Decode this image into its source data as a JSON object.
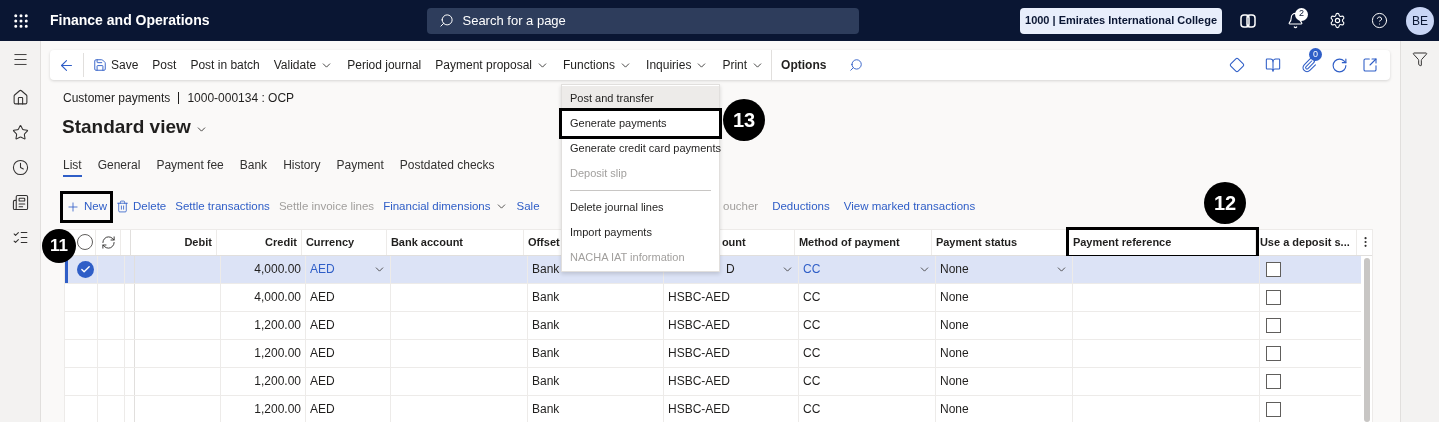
{
  "app": {
    "title": "Finance and Operations"
  },
  "search": {
    "placeholder": "Search for a page"
  },
  "company": "1000 | Emirates International College",
  "notifications": {
    "count": "2"
  },
  "avatar": "BE",
  "action_pane": {
    "items": [
      {
        "label": "Save",
        "kind": "save"
      },
      {
        "label": "Post",
        "kind": "plain"
      },
      {
        "label": "Post in batch",
        "kind": "plain"
      },
      {
        "label": "Validate",
        "kind": "dropdown"
      },
      {
        "label": "Period journal",
        "kind": "plain"
      },
      {
        "label": "Payment proposal",
        "kind": "dropdown"
      },
      {
        "label": "Functions",
        "kind": "dropdown"
      },
      {
        "label": "Inquiries",
        "kind": "dropdown"
      },
      {
        "label": "Print",
        "kind": "dropdown"
      },
      {
        "label": "Options",
        "kind": "bold"
      }
    ],
    "attachments_count": "0"
  },
  "breadcrumb": {
    "title": "Customer payments",
    "record": "1000-000134 : OCP"
  },
  "view": "Standard view",
  "tabs": [
    {
      "label": "List",
      "selected": true
    },
    {
      "label": "General",
      "selected": false
    },
    {
      "label": "Payment fee",
      "selected": false
    },
    {
      "label": "Bank",
      "selected": false
    },
    {
      "label": "History",
      "selected": false
    },
    {
      "label": "Payment",
      "selected": false
    },
    {
      "label": "Postdated checks",
      "selected": false
    }
  ],
  "grid_actions": [
    {
      "label": "New",
      "kind": "new",
      "disabled": false
    },
    {
      "label": "Delete",
      "kind": "delete",
      "disabled": false
    },
    {
      "label": "Settle transactions",
      "kind": "plain",
      "disabled": false
    },
    {
      "label": "Settle invoice lines",
      "kind": "plain",
      "disabled": true
    },
    {
      "label": "Financial dimensions",
      "kind": "dropdown",
      "disabled": false
    },
    {
      "label": "Sale",
      "kind": "plain",
      "disabled": false
    },
    {
      "label": "oucher",
      "kind": "after_menu",
      "disabled": true
    },
    {
      "label": "Deductions",
      "kind": "plain",
      "disabled": false
    },
    {
      "label": "View marked transactions",
      "kind": "plain",
      "disabled": false
    }
  ],
  "table": {
    "select_all": {
      "checked": false
    },
    "columns": [
      {
        "label": "Debit",
        "kind": "numeric"
      },
      {
        "label": "Credit",
        "kind": "numeric"
      },
      {
        "label": "Currency",
        "kind": "text"
      },
      {
        "label": "Bank account",
        "kind": "text"
      },
      {
        "label": "Offset",
        "kind": "text"
      },
      {
        "label": "ount",
        "kind": "partial"
      },
      {
        "label": "Method of payment",
        "kind": "text"
      },
      {
        "label": "Payment status",
        "kind": "text"
      },
      {
        "label": "Payment reference",
        "kind": "text"
      },
      {
        "label": "Use a deposit s...",
        "kind": "text"
      }
    ],
    "rows": [
      {
        "selected": true,
        "credit": "4,000.00",
        "currency": "AED",
        "offset": "Bank",
        "offset_account": "D",
        "method": "CC",
        "status": "None",
        "deposit": false
      },
      {
        "selected": false,
        "credit": "4,000.00",
        "currency": "AED",
        "offset": "Bank",
        "offset_account": "HSBC-AED",
        "method": "CC",
        "status": "None",
        "deposit": false
      },
      {
        "selected": false,
        "credit": "1,200.00",
        "currency": "AED",
        "offset": "Bank",
        "offset_account": "HSBC-AED",
        "method": "CC",
        "status": "None",
        "deposit": false
      },
      {
        "selected": false,
        "credit": "1,200.00",
        "currency": "AED",
        "offset": "Bank",
        "offset_account": "HSBC-AED",
        "method": "CC",
        "status": "None",
        "deposit": false
      },
      {
        "selected": false,
        "credit": "1,200.00",
        "currency": "AED",
        "offset": "Bank",
        "offset_account": "HSBC-AED",
        "method": "CC",
        "status": "None",
        "deposit": false
      },
      {
        "selected": false,
        "credit": "1,200.00",
        "currency": "AED",
        "offset": "Bank",
        "offset_account": "HSBC-AED",
        "method": "CC",
        "status": "None",
        "deposit": false
      }
    ]
  },
  "menu": {
    "items": [
      {
        "kind": "item",
        "label": "Post and transfer",
        "highlighted": true,
        "disabled": false
      },
      {
        "kind": "item",
        "label": "Generate payments",
        "highlighted": false,
        "disabled": false
      },
      {
        "kind": "item",
        "label": "Generate credit card payments",
        "highlighted": false,
        "disabled": false
      },
      {
        "kind": "item",
        "label": "Deposit slip",
        "highlighted": false,
        "disabled": true
      },
      {
        "kind": "divider"
      },
      {
        "kind": "item",
        "label": "Delete journal lines",
        "highlighted": false,
        "disabled": false
      },
      {
        "kind": "item",
        "label": "Import payments",
        "highlighted": false,
        "disabled": false
      },
      {
        "kind": "item",
        "label": "NACHA IAT information",
        "highlighted": false,
        "disabled": true
      }
    ]
  },
  "callouts": [
    {
      "label": "11"
    },
    {
      "label": "12"
    },
    {
      "label": "13"
    }
  ]
}
